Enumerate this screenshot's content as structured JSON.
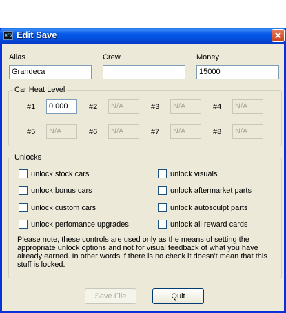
{
  "window": {
    "title": "Edit Save",
    "icon_text": "OFS",
    "close_symbol": "✕"
  },
  "fields": {
    "alias": {
      "label": "Alias",
      "value": "Grandeca"
    },
    "crew": {
      "label": "Crew",
      "value": ""
    },
    "money": {
      "label": "Money",
      "value": "15000"
    }
  },
  "heat": {
    "title": "Car Heat Level",
    "cars": [
      {
        "label": "#1",
        "value": "0.000",
        "enabled": true
      },
      {
        "label": "#2",
        "value": "N/A",
        "enabled": false
      },
      {
        "label": "#3",
        "value": "N/A",
        "enabled": false
      },
      {
        "label": "#4",
        "value": "N/A",
        "enabled": false
      },
      {
        "label": "#5",
        "value": "N/A",
        "enabled": false
      },
      {
        "label": "#6",
        "value": "N/A",
        "enabled": false
      },
      {
        "label": "#7",
        "value": "N/A",
        "enabled": false
      },
      {
        "label": "#8",
        "value": "N/A",
        "enabled": false
      }
    ]
  },
  "unlocks": {
    "title": "Unlocks",
    "items": [
      {
        "label": "unlock stock cars",
        "checked": false
      },
      {
        "label": "unlock visuals",
        "checked": false
      },
      {
        "label": "unlock bonus cars",
        "checked": false
      },
      {
        "label": "unlock aftermarket parts",
        "checked": false
      },
      {
        "label": "unlock custom cars",
        "checked": false
      },
      {
        "label": "unlock autosculpt parts",
        "checked": false
      },
      {
        "label": "unlock perfomance upgrades",
        "checked": false
      },
      {
        "label": "unlock all reward cards",
        "checked": false
      }
    ],
    "note": "Please note, these controls are used only as the means of setting the appropriate unlock options and not for visual feedback of what you have already earned. In other words if there is no check it doesn't mean that this stuff is locked."
  },
  "buttons": {
    "save": "Save File",
    "quit": "Quit"
  }
}
